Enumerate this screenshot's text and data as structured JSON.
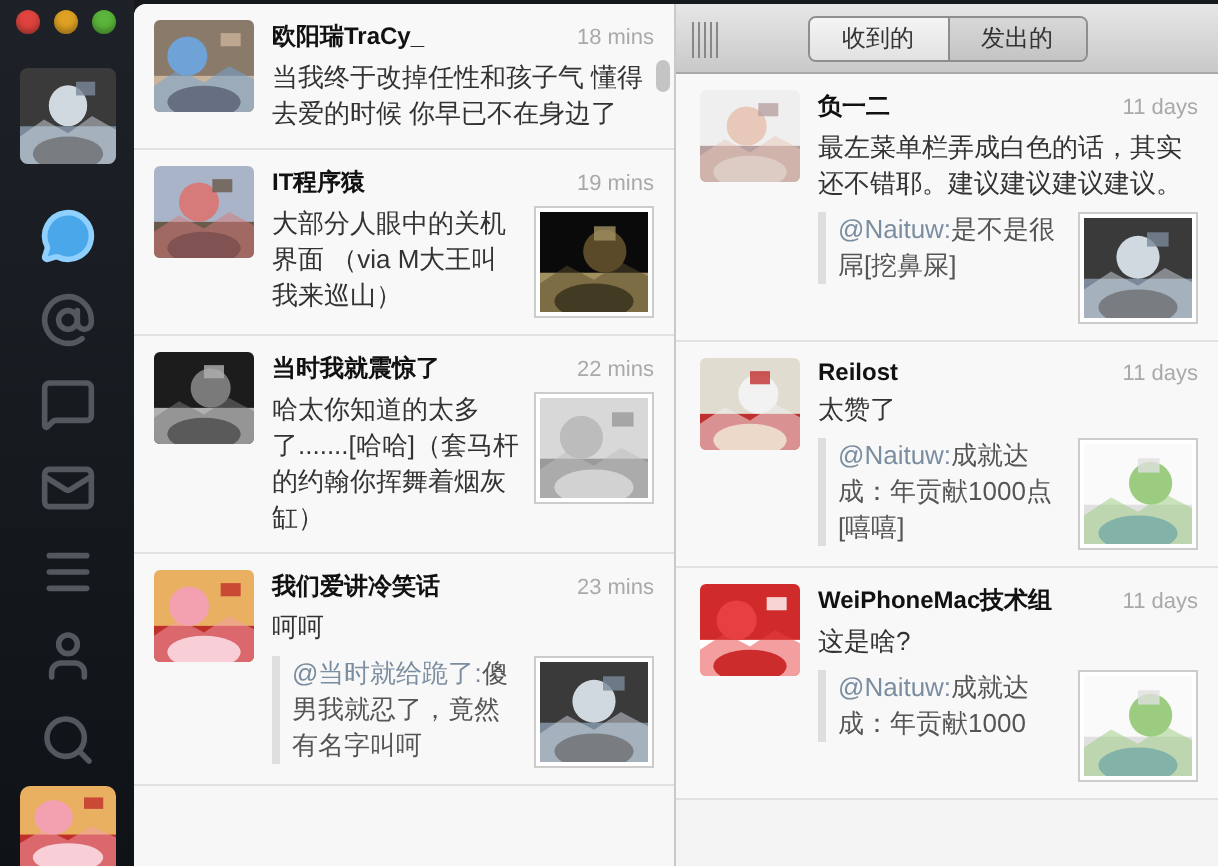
{
  "sidebar": {
    "icons": [
      {
        "kind": "chat",
        "selected": true
      },
      {
        "kind": "mention",
        "selected": false
      },
      {
        "kind": "comment",
        "selected": false
      },
      {
        "kind": "inbox",
        "selected": false
      },
      {
        "kind": "list",
        "selected": false
      },
      {
        "kind": "profile",
        "selected": false
      },
      {
        "kind": "search",
        "selected": false
      }
    ]
  },
  "left_timeline": {
    "items": [
      {
        "name": "欧阳瑞TraCy_",
        "time": "18 mins",
        "text": "当我终于改掉任性和孩子气 懂得去爱的时候 你早已不在身边了"
      },
      {
        "name": "IT程序猿",
        "time": "19 mins",
        "text": "大部分人眼中的关机界面 （via M大王叫我来巡山）"
      },
      {
        "name": "当时我就震惊了",
        "time": "22 mins",
        "text": "哈太你知道的太多了.......[哈哈]（套马杆的约翰你挥舞着烟灰缸）"
      },
      {
        "name": "我们爱讲冷笑话",
        "time": "23 mins",
        "text": "呵呵",
        "quote": {
          "mention": "@当时就给跪了:",
          "text": "傻男我就忍了，竟然有名字叫呵"
        }
      }
    ]
  },
  "right_panel": {
    "tabs": [
      {
        "label": "收到的",
        "selected": true
      },
      {
        "label": "发出的",
        "selected": false
      }
    ],
    "items": [
      {
        "name": "负一二",
        "time": "11 days",
        "text": "最左菜单栏弄成白色的话，其实还不错耶。建议建议建议建议。",
        "quote": {
          "mention": "@Naituw:",
          "text": "是不是很屌[挖鼻屎]"
        }
      },
      {
        "name": "Reilost",
        "time": "11 days",
        "text": "太赞了",
        "quote": {
          "mention": "@Naituw:",
          "text": "成就达成：年贡献1000点 [嘻嘻]"
        }
      },
      {
        "name": "WeiPhoneMac技术组",
        "time": "11 days",
        "text": "这是啥?",
        "quote": {
          "mention": "@Naituw:",
          "text": "成就达成：年贡献1000"
        }
      }
    ]
  }
}
